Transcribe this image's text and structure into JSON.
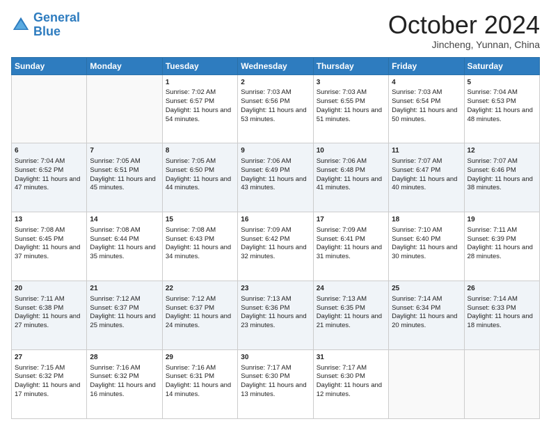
{
  "logo": {
    "line1": "General",
    "line2": "Blue"
  },
  "title": "October 2024",
  "location": "Jincheng, Yunnan, China",
  "days_of_week": [
    "Sunday",
    "Monday",
    "Tuesday",
    "Wednesday",
    "Thursday",
    "Friday",
    "Saturday"
  ],
  "weeks": [
    [
      {
        "day": "",
        "sunrise": "",
        "sunset": "",
        "daylight": ""
      },
      {
        "day": "",
        "sunrise": "",
        "sunset": "",
        "daylight": ""
      },
      {
        "day": "1",
        "sunrise": "Sunrise: 7:02 AM",
        "sunset": "Sunset: 6:57 PM",
        "daylight": "Daylight: 11 hours and 54 minutes."
      },
      {
        "day": "2",
        "sunrise": "Sunrise: 7:03 AM",
        "sunset": "Sunset: 6:56 PM",
        "daylight": "Daylight: 11 hours and 53 minutes."
      },
      {
        "day": "3",
        "sunrise": "Sunrise: 7:03 AM",
        "sunset": "Sunset: 6:55 PM",
        "daylight": "Daylight: 11 hours and 51 minutes."
      },
      {
        "day": "4",
        "sunrise": "Sunrise: 7:03 AM",
        "sunset": "Sunset: 6:54 PM",
        "daylight": "Daylight: 11 hours and 50 minutes."
      },
      {
        "day": "5",
        "sunrise": "Sunrise: 7:04 AM",
        "sunset": "Sunset: 6:53 PM",
        "daylight": "Daylight: 11 hours and 48 minutes."
      }
    ],
    [
      {
        "day": "6",
        "sunrise": "Sunrise: 7:04 AM",
        "sunset": "Sunset: 6:52 PM",
        "daylight": "Daylight: 11 hours and 47 minutes."
      },
      {
        "day": "7",
        "sunrise": "Sunrise: 7:05 AM",
        "sunset": "Sunset: 6:51 PM",
        "daylight": "Daylight: 11 hours and 45 minutes."
      },
      {
        "day": "8",
        "sunrise": "Sunrise: 7:05 AM",
        "sunset": "Sunset: 6:50 PM",
        "daylight": "Daylight: 11 hours and 44 minutes."
      },
      {
        "day": "9",
        "sunrise": "Sunrise: 7:06 AM",
        "sunset": "Sunset: 6:49 PM",
        "daylight": "Daylight: 11 hours and 43 minutes."
      },
      {
        "day": "10",
        "sunrise": "Sunrise: 7:06 AM",
        "sunset": "Sunset: 6:48 PM",
        "daylight": "Daylight: 11 hours and 41 minutes."
      },
      {
        "day": "11",
        "sunrise": "Sunrise: 7:07 AM",
        "sunset": "Sunset: 6:47 PM",
        "daylight": "Daylight: 11 hours and 40 minutes."
      },
      {
        "day": "12",
        "sunrise": "Sunrise: 7:07 AM",
        "sunset": "Sunset: 6:46 PM",
        "daylight": "Daylight: 11 hours and 38 minutes."
      }
    ],
    [
      {
        "day": "13",
        "sunrise": "Sunrise: 7:08 AM",
        "sunset": "Sunset: 6:45 PM",
        "daylight": "Daylight: 11 hours and 37 minutes."
      },
      {
        "day": "14",
        "sunrise": "Sunrise: 7:08 AM",
        "sunset": "Sunset: 6:44 PM",
        "daylight": "Daylight: 11 hours and 35 minutes."
      },
      {
        "day": "15",
        "sunrise": "Sunrise: 7:08 AM",
        "sunset": "Sunset: 6:43 PM",
        "daylight": "Daylight: 11 hours and 34 minutes."
      },
      {
        "day": "16",
        "sunrise": "Sunrise: 7:09 AM",
        "sunset": "Sunset: 6:42 PM",
        "daylight": "Daylight: 11 hours and 32 minutes."
      },
      {
        "day": "17",
        "sunrise": "Sunrise: 7:09 AM",
        "sunset": "Sunset: 6:41 PM",
        "daylight": "Daylight: 11 hours and 31 minutes."
      },
      {
        "day": "18",
        "sunrise": "Sunrise: 7:10 AM",
        "sunset": "Sunset: 6:40 PM",
        "daylight": "Daylight: 11 hours and 30 minutes."
      },
      {
        "day": "19",
        "sunrise": "Sunrise: 7:11 AM",
        "sunset": "Sunset: 6:39 PM",
        "daylight": "Daylight: 11 hours and 28 minutes."
      }
    ],
    [
      {
        "day": "20",
        "sunrise": "Sunrise: 7:11 AM",
        "sunset": "Sunset: 6:38 PM",
        "daylight": "Daylight: 11 hours and 27 minutes."
      },
      {
        "day": "21",
        "sunrise": "Sunrise: 7:12 AM",
        "sunset": "Sunset: 6:37 PM",
        "daylight": "Daylight: 11 hours and 25 minutes."
      },
      {
        "day": "22",
        "sunrise": "Sunrise: 7:12 AM",
        "sunset": "Sunset: 6:37 PM",
        "daylight": "Daylight: 11 hours and 24 minutes."
      },
      {
        "day": "23",
        "sunrise": "Sunrise: 7:13 AM",
        "sunset": "Sunset: 6:36 PM",
        "daylight": "Daylight: 11 hours and 23 minutes."
      },
      {
        "day": "24",
        "sunrise": "Sunrise: 7:13 AM",
        "sunset": "Sunset: 6:35 PM",
        "daylight": "Daylight: 11 hours and 21 minutes."
      },
      {
        "day": "25",
        "sunrise": "Sunrise: 7:14 AM",
        "sunset": "Sunset: 6:34 PM",
        "daylight": "Daylight: 11 hours and 20 minutes."
      },
      {
        "day": "26",
        "sunrise": "Sunrise: 7:14 AM",
        "sunset": "Sunset: 6:33 PM",
        "daylight": "Daylight: 11 hours and 18 minutes."
      }
    ],
    [
      {
        "day": "27",
        "sunrise": "Sunrise: 7:15 AM",
        "sunset": "Sunset: 6:32 PM",
        "daylight": "Daylight: 11 hours and 17 minutes."
      },
      {
        "day": "28",
        "sunrise": "Sunrise: 7:16 AM",
        "sunset": "Sunset: 6:32 PM",
        "daylight": "Daylight: 11 hours and 16 minutes."
      },
      {
        "day": "29",
        "sunrise": "Sunrise: 7:16 AM",
        "sunset": "Sunset: 6:31 PM",
        "daylight": "Daylight: 11 hours and 14 minutes."
      },
      {
        "day": "30",
        "sunrise": "Sunrise: 7:17 AM",
        "sunset": "Sunset: 6:30 PM",
        "daylight": "Daylight: 11 hours and 13 minutes."
      },
      {
        "day": "31",
        "sunrise": "Sunrise: 7:17 AM",
        "sunset": "Sunset: 6:30 PM",
        "daylight": "Daylight: 11 hours and 12 minutes."
      },
      {
        "day": "",
        "sunrise": "",
        "sunset": "",
        "daylight": ""
      },
      {
        "day": "",
        "sunrise": "",
        "sunset": "",
        "daylight": ""
      }
    ]
  ]
}
